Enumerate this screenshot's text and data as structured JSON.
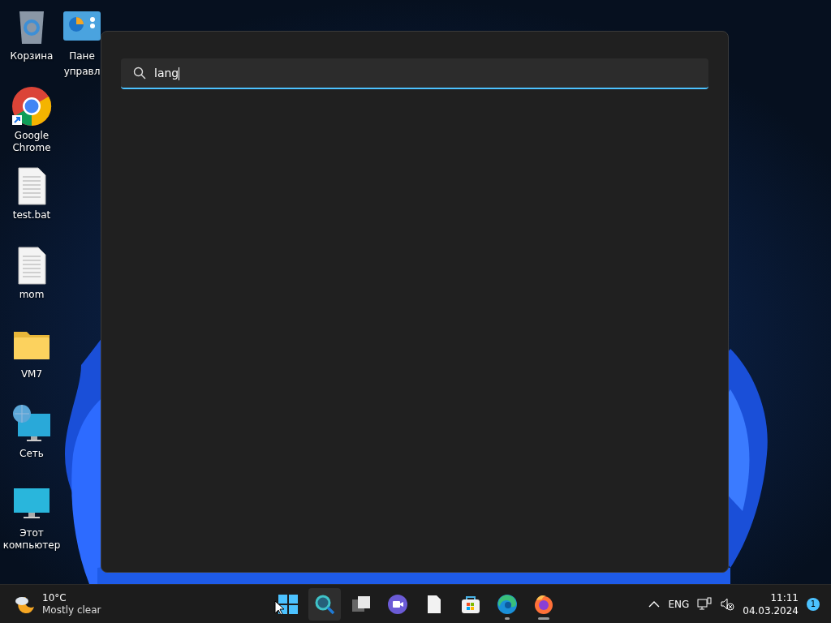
{
  "desktop_icons": [
    {
      "kind": "recycle-bin",
      "label": "Корзина"
    },
    {
      "kind": "chrome",
      "label": "Google Chrome"
    },
    {
      "kind": "document",
      "label": "test.bat"
    },
    {
      "kind": "document",
      "label": "mom"
    },
    {
      "kind": "folder",
      "label": "VM7"
    },
    {
      "kind": "network",
      "label": "Сеть"
    },
    {
      "kind": "computer",
      "label": "Этот компьютер"
    }
  ],
  "partial_icon": {
    "kind": "control-panel",
    "lines": [
      "Пане",
      "управл"
    ]
  },
  "search_window": {
    "search": {
      "value": "lang"
    }
  },
  "taskbar": {
    "weather": {
      "temperature": "10°C",
      "condition": "Mostly clear"
    },
    "apps": [
      {
        "kind": "start",
        "selected": false,
        "running": false
      },
      {
        "kind": "search",
        "selected": true,
        "running": false
      },
      {
        "kind": "task-view",
        "selected": false,
        "running": false
      },
      {
        "kind": "meet",
        "selected": false,
        "running": false
      },
      {
        "kind": "notepad",
        "selected": false,
        "running": false
      },
      {
        "kind": "store",
        "selected": false,
        "running": false
      },
      {
        "kind": "edge",
        "selected": false,
        "running": true
      },
      {
        "kind": "firefox",
        "selected": false,
        "running": true
      }
    ],
    "tray": {
      "language": "ENG",
      "time": "11:11",
      "date": "04.03.2024",
      "notifications": "1"
    }
  }
}
